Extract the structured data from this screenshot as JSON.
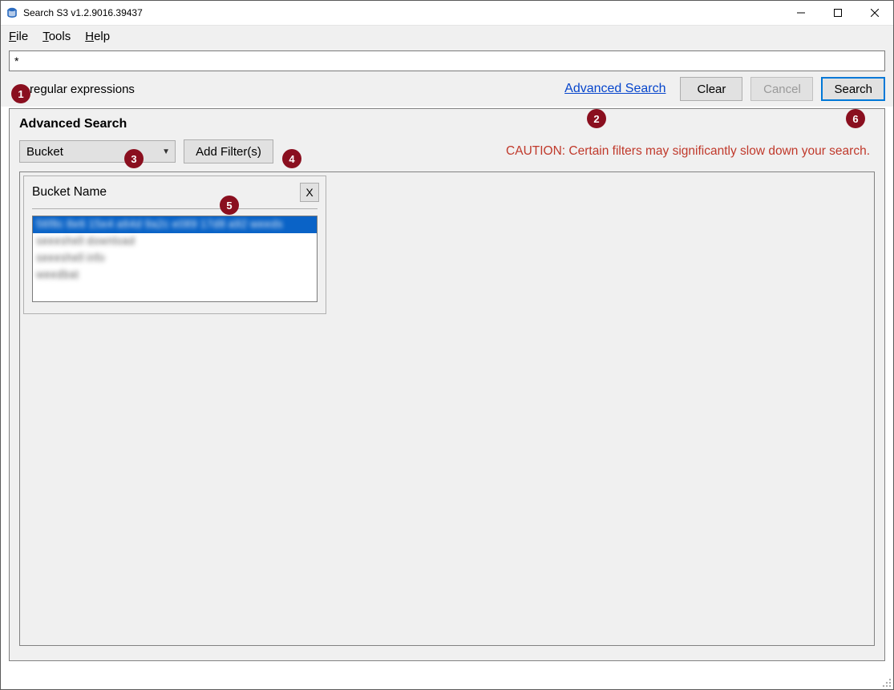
{
  "window": {
    "title": "Search S3 v1.2.9016.39437"
  },
  "menu": {
    "file": "File",
    "tools": "Tools",
    "help": "Help"
  },
  "search": {
    "value": "*",
    "regex_label": "se regular expressions",
    "advanced_link": "Advanced Search",
    "clear_btn": "Clear",
    "cancel_btn": "Cancel",
    "search_btn": "Search"
  },
  "advanced": {
    "title": "Advanced Search",
    "filter_select": "Bucket",
    "add_filter_btn": "Add Filter(s)",
    "caution": "CAUTION: Certain filters may significantly slow down your search."
  },
  "filter_card": {
    "title": "Bucket Name",
    "close": "X",
    "items": [
      "56f8c 8e6 15e4 a64d 9a2c e089 17d8 a92 weeds",
      "seeeshell download",
      "seeeshell info",
      "weedbat"
    ]
  },
  "badges": {
    "b1": "1",
    "b2": "2",
    "b3": "3",
    "b4": "4",
    "b5": "5",
    "b6": "6"
  }
}
